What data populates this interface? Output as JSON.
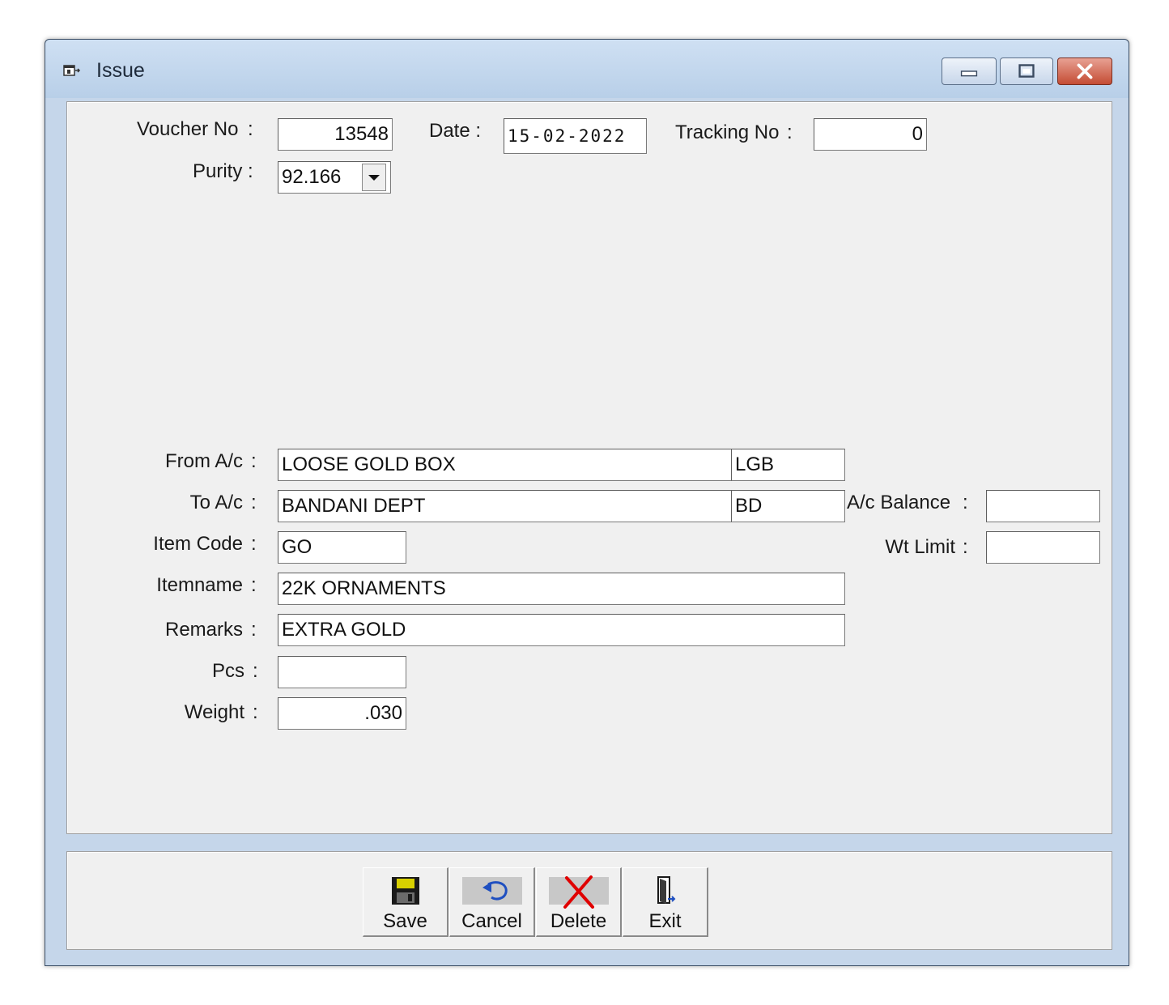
{
  "window": {
    "title": "Issue",
    "icon": "form-window-icon",
    "controls": [
      "minimize-icon",
      "maximize-icon",
      "close-icon"
    ]
  },
  "form": {
    "voucher_no": {
      "label": "Voucher No",
      "value": "13548"
    },
    "date": {
      "label": "Date :",
      "value": "15-02-2022"
    },
    "tracking_no": {
      "label": "Tracking No",
      "value": "0"
    },
    "purity": {
      "label": "Purity",
      "value": "92.166"
    },
    "from_ac": {
      "label": "From A/c",
      "name": "LOOSE GOLD BOX",
      "code": "LGB"
    },
    "to_ac": {
      "label": "To A/c",
      "name": "BANDANI DEPT",
      "code": "BD"
    },
    "ac_balance": {
      "label": "A/c Balance",
      "value": ""
    },
    "wt_limit": {
      "label": "Wt Limit",
      "value": ""
    },
    "item_code": {
      "label": "Item Code",
      "value": "GO"
    },
    "itemname": {
      "label": "Itemname",
      "value": "22K ORNAMENTS"
    },
    "remarks": {
      "label": "Remarks",
      "value": "EXTRA GOLD"
    },
    "pcs": {
      "label": "Pcs",
      "value": ""
    },
    "weight": {
      "label": "Weight",
      "value": ".030"
    },
    "colon": ":"
  },
  "toolbar": {
    "save": {
      "label": "Save",
      "icon": "floppy-disk-icon"
    },
    "cancel": {
      "label": "Cancel",
      "icon": "undo-arrow-icon"
    },
    "delete": {
      "label": "Delete",
      "icon": "red-x-icon"
    },
    "exit": {
      "label": "Exit",
      "icon": "door-exit-icon"
    }
  }
}
